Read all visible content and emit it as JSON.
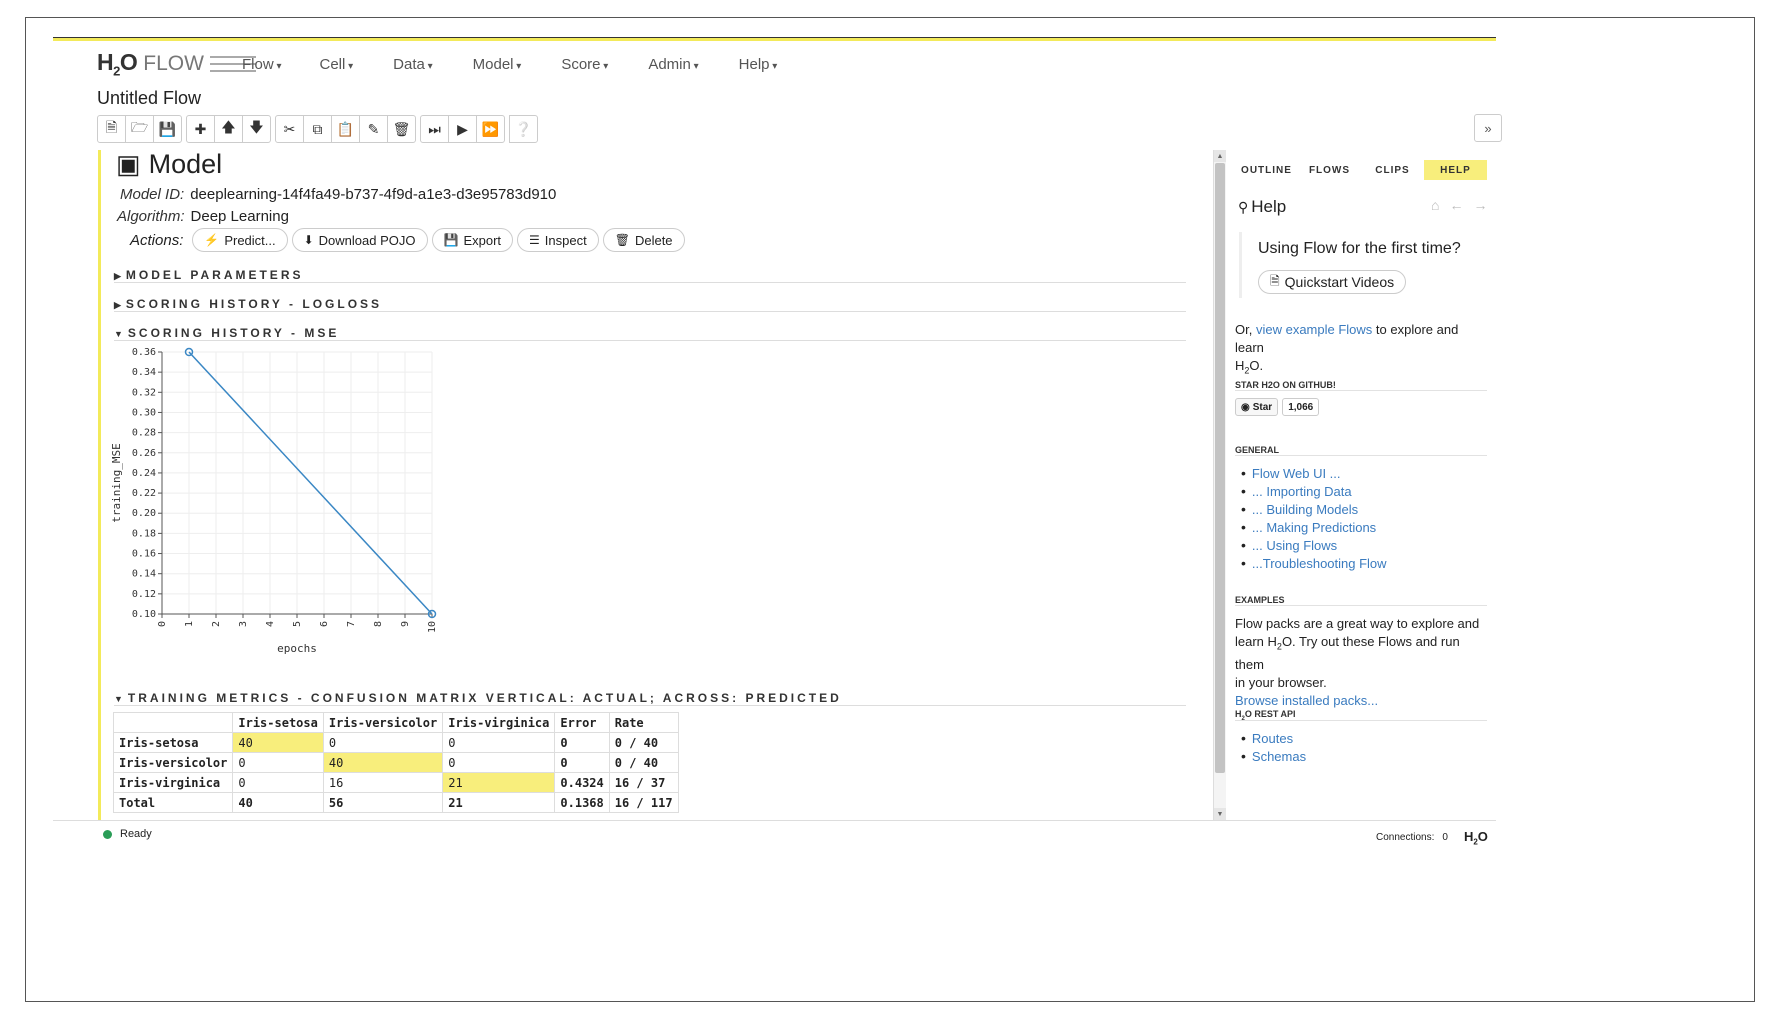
{
  "app": {
    "brand_h": "H",
    "brand_sub": "2",
    "brand_o": "O",
    "brand_flow": "FLOW"
  },
  "nav": [
    "Flow",
    "Cell",
    "Data",
    "Model",
    "Score",
    "Admin",
    "Help"
  ],
  "flow_title": "Untitled Flow",
  "model": {
    "title": "Model",
    "id_label": "Model ID:",
    "id_value": "deeplearning-14f4fa49-b737-4f9d-a1e3-d3e95783d910",
    "algo_label": "Algorithm:",
    "algo_value": "Deep Learning",
    "actions_label": "Actions:",
    "actions": [
      "Predict...",
      "Download POJO",
      "Export",
      "Inspect",
      "Delete"
    ]
  },
  "sections": {
    "params": "MODEL PARAMETERS",
    "logloss": "SCORING HISTORY - LOGLOSS",
    "mse": "SCORING HISTORY - MSE",
    "confusion": "TRAINING METRICS - CONFUSION MATRIX VERTICAL: ACTUAL; ACROSS: PREDICTED"
  },
  "chart_data": {
    "type": "line",
    "xlabel": "epochs",
    "ylabel": "training_MSE",
    "xlim": [
      0,
      10
    ],
    "ylim": [
      0.1,
      0.36
    ],
    "x_ticks": [
      "0",
      "1",
      "2",
      "3",
      "4",
      "5",
      "6",
      "7",
      "8",
      "9",
      "10"
    ],
    "y_ticks": [
      "0.36",
      "0.34",
      "0.32",
      "0.30",
      "0.28",
      "0.26",
      "0.24",
      "0.22",
      "0.20",
      "0.18",
      "0.16",
      "0.14",
      "0.12",
      "0.10"
    ],
    "series": [
      {
        "x": [
          1,
          10
        ],
        "y": [
          0.36,
          0.1
        ]
      }
    ],
    "grid": true,
    "color": "#3a87c4"
  },
  "confusion_matrix": {
    "headers": [
      "",
      "Iris-setosa",
      "Iris-versicolor",
      "Iris-virginica",
      "Error",
      "Rate"
    ],
    "rows": [
      [
        "Iris-setosa",
        "40",
        "0",
        "0",
        "0",
        "0 / 40"
      ],
      [
        "Iris-versicolor",
        "0",
        "40",
        "0",
        "0",
        "0 / 40"
      ],
      [
        "Iris-virginica",
        "0",
        "16",
        "21",
        "0.4324",
        "16 / 37"
      ],
      [
        "Total",
        "40",
        "56",
        "21",
        "0.1368",
        "16 / 117"
      ]
    ],
    "highlight_color": "#f8ee7c"
  },
  "right_panel": {
    "tabs": [
      "OUTLINE",
      "FLOWS",
      "CLIPS",
      "HELP"
    ],
    "help_title": "Help",
    "first_time": "Using Flow for the first time?",
    "quickstart": "Quickstart Videos",
    "or_prefix": "Or,",
    "or_link": "view example Flows",
    "or_suffix": "to explore and learn",
    "or_h2o_h": "H",
    "or_h2o_sub": "2",
    "or_h2o_o": "O.",
    "star_heading": "STAR H2O ON GITHUB!",
    "star_label": "Star",
    "star_count": "1,066",
    "general_heading": "GENERAL",
    "general_links": [
      "Flow Web UI ...",
      "... Importing Data",
      "... Building Models",
      "... Making Predictions",
      "... Using Flows",
      "...Troubleshooting Flow"
    ],
    "examples_heading": "EXAMPLES",
    "examples_l1": "Flow packs are a great way to explore and",
    "examples_l2a": "learn H",
    "examples_l2sub": "2",
    "examples_l2b": "O. Try out these Flows and run them",
    "examples_l3": "in your browser.",
    "examples_link": "Browse installed packs...",
    "rest_heading_h": "H",
    "rest_heading_sub": "2",
    "rest_heading_rest": "O REST API",
    "rest_links": [
      "Routes",
      "Schemas"
    ]
  },
  "status": {
    "text": "Ready",
    "connections_label": "Connections:",
    "connections_value": "0",
    "logo_h": "H",
    "logo_sub": "2",
    "logo_o": "O"
  }
}
